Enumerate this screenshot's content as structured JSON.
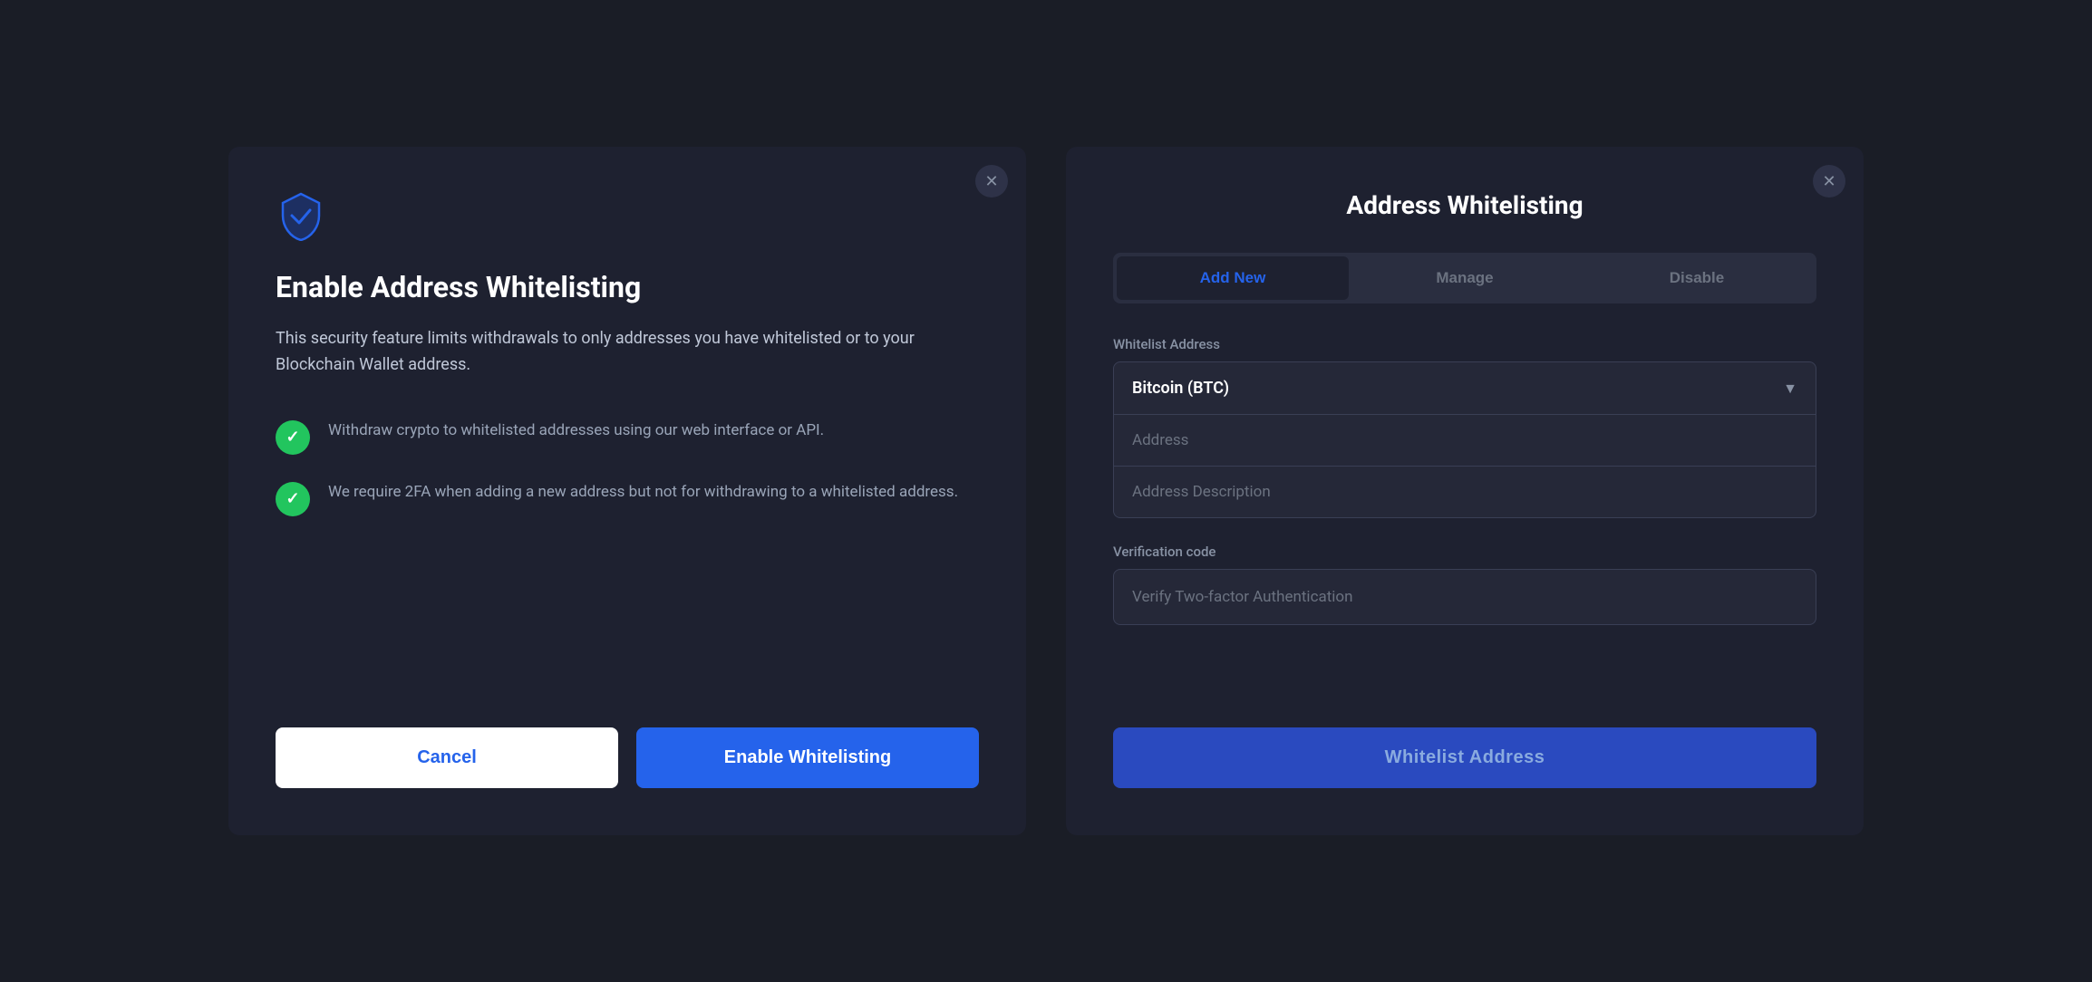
{
  "left_panel": {
    "title": "Enable Address Whitelisting",
    "description": "This security feature limits withdrawals to only addresses you have whitelisted or to your Blockchain Wallet address.",
    "features": [
      {
        "text": "Withdraw crypto to whitelisted addresses using our web interface or API."
      },
      {
        "text": "We require 2FA when adding a new address but not for withdrawing to a whitelisted address."
      }
    ],
    "cancel_label": "Cancel",
    "enable_label": "Enable Whitelisting",
    "close_icon": "✕"
  },
  "right_panel": {
    "title": "Address Whitelisting",
    "tabs": [
      {
        "label": "Add New",
        "active": true
      },
      {
        "label": "Manage",
        "active": false
      },
      {
        "label": "Disable",
        "active": false
      }
    ],
    "whitelist_address_label": "Whitelist Address",
    "dropdown_value": "Bitcoin (BTC)",
    "address_placeholder": "Address",
    "address_description_placeholder": "Address Description",
    "verification_label": "Verification code",
    "verify_placeholder": "Verify Two-factor Authentication",
    "whitelist_button_label": "Whitelist Address",
    "close_icon": "✕"
  }
}
